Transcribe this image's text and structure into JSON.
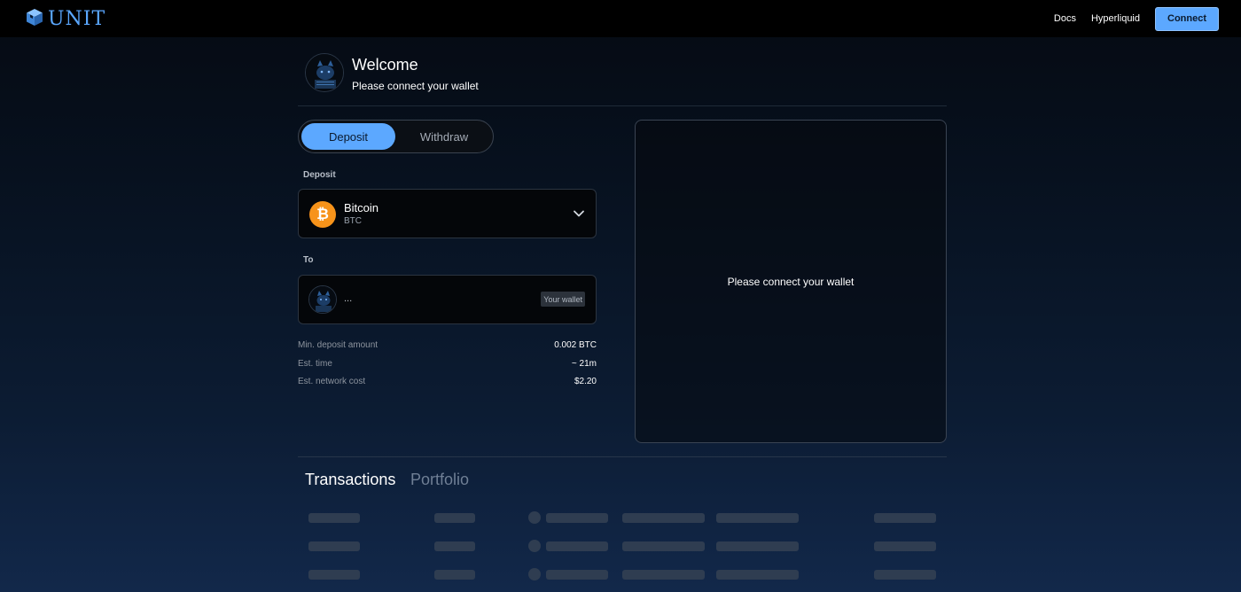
{
  "header": {
    "logo_text": "UNIT",
    "nav": {
      "docs": "Docs",
      "hyperliquid": "Hyperliquid"
    },
    "connect_label": "Connect"
  },
  "welcome": {
    "title": "Welcome",
    "subtitle": "Please connect your wallet"
  },
  "tabs": {
    "deposit": "Deposit",
    "withdraw": "Withdraw",
    "active": "Deposit"
  },
  "form": {
    "deposit_label": "Deposit",
    "asset": {
      "name": "Bitcoin",
      "ticker": "BTC",
      "icon": "bitcoin-icon"
    },
    "to_label": "To",
    "to_address": "...",
    "wallet_badge": "Your wallet",
    "info": [
      {
        "label": "Min. deposit amount",
        "value": "0.002 BTC"
      },
      {
        "label": "Est. time",
        "value": "~ 21m"
      },
      {
        "label": "Est. network cost",
        "value": "$2.20"
      }
    ]
  },
  "panel": {
    "message": "Please connect your wallet"
  },
  "bottom_tabs": {
    "transactions": "Transactions",
    "portfolio": "Portfolio",
    "active": "Transactions"
  },
  "colors": {
    "accent": "#5ca8ff",
    "bitcoin": "#f7931a",
    "background_top": "#050a12",
    "background_bottom": "#12284a"
  }
}
